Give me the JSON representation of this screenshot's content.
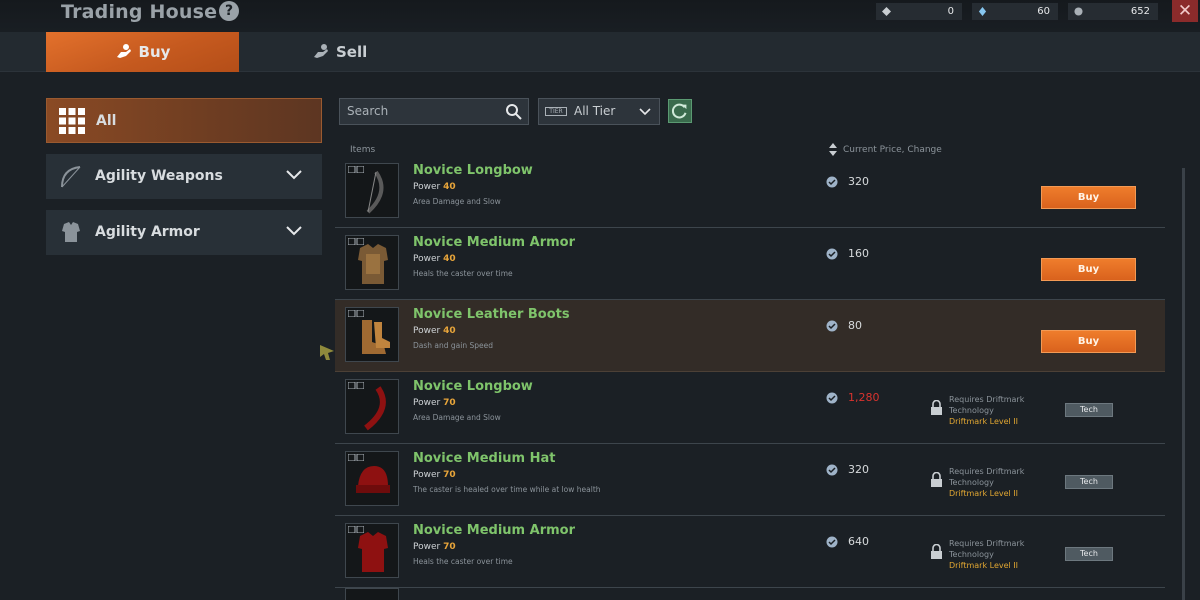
{
  "window": {
    "title": "Trading House"
  },
  "currencies": [
    {
      "icon": "crystal-icon",
      "value": "0"
    },
    {
      "icon": "diamond-icon",
      "value": "60"
    },
    {
      "icon": "coin-icon",
      "value": "652"
    }
  ],
  "tabs": [
    {
      "label": "Buy",
      "icon": "buy-hand-icon",
      "active": true
    },
    {
      "label": "Sell",
      "icon": "sell-hand-icon",
      "active": false
    }
  ],
  "sidebar": {
    "items": [
      {
        "label": "All",
        "icon": "grid-icon",
        "active": true
      },
      {
        "label": "Agility Weapons",
        "icon": "bow-icon",
        "active": false
      },
      {
        "label": "Agility Armor",
        "icon": "armor-icon",
        "active": false
      }
    ]
  },
  "filters": {
    "search_placeholder": "Search",
    "tier_badge": "TIER",
    "tier_value": "All Tier"
  },
  "table": {
    "col_items": "Items",
    "col_price": "Current Price, Change",
    "rows": [
      {
        "name": "Novice Longbow",
        "power_label": "Power",
        "power": "40",
        "desc": "Area Damage and Slow",
        "price": "320",
        "action": "Buy",
        "locked": false
      },
      {
        "name": "Novice Medium Armor",
        "power_label": "Power",
        "power": "40",
        "desc": "Heals the caster over time",
        "price": "160",
        "action": "Buy",
        "locked": false
      },
      {
        "name": "Novice Leather Boots",
        "power_label": "Power",
        "power": "40",
        "desc": "Dash and gain Speed",
        "price": "80",
        "action": "Buy",
        "locked": false
      },
      {
        "name": "Novice Longbow",
        "power_label": "Power",
        "power": "70",
        "desc": "Area Damage and Slow",
        "price": "1,280",
        "action": "Tech",
        "locked": true,
        "req_line1": "Requires Driftmark",
        "req_line2": "Technology",
        "req_level": "Driftmark Level II"
      },
      {
        "name": "Novice Medium Hat",
        "power_label": "Power",
        "power": "70",
        "desc": "The caster is healed over time while at low health",
        "price": "320",
        "action": "Tech",
        "locked": true,
        "req_line1": "Requires Driftmark",
        "req_line2": "Technology",
        "req_level": "Driftmark Level II"
      },
      {
        "name": "Novice Medium Armor",
        "power_label": "Power",
        "power": "70",
        "desc": "Heals the caster over time",
        "price": "640",
        "action": "Tech",
        "locked": true,
        "req_line1": "Requires Driftmark",
        "req_line2": "Technology",
        "req_level": "Driftmark Level II"
      }
    ]
  },
  "colors": {
    "accent": "#e3712c",
    "item_name": "#7fc46b",
    "power_value": "#e8a53a",
    "price_unaffordable": "#d9332e",
    "req_level": "#e0a632"
  }
}
